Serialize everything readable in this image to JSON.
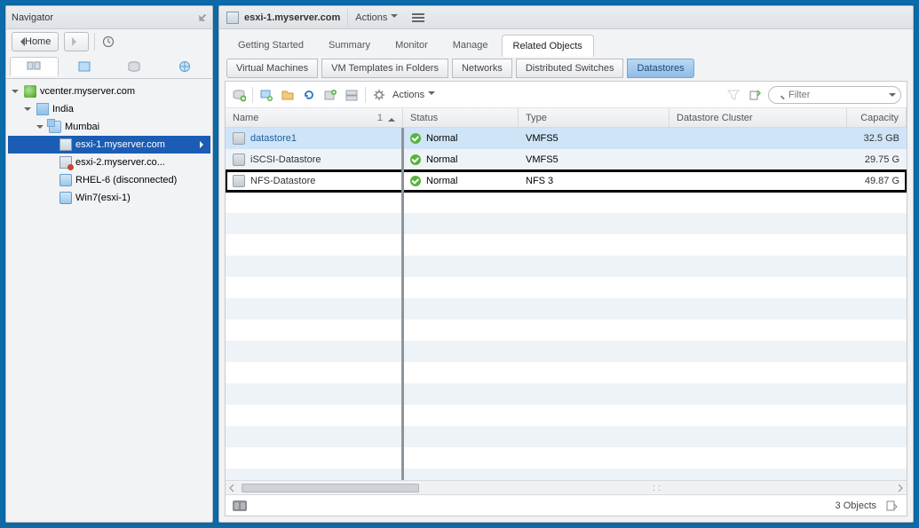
{
  "navigator": {
    "title": "Navigator",
    "home": "Home"
  },
  "tree": {
    "vcenter": "vcenter.myserver.com",
    "dc": "India",
    "cluster": "Mumbai",
    "host1": "esxi-1.myserver.com",
    "host2": "esxi-2.myserver.co...",
    "vm1": "RHEL-6 (disconnected)",
    "vm2": "Win7(esxi-1)"
  },
  "header": {
    "object": "esxi-1.myserver.com",
    "actions": "Actions"
  },
  "tabs": {
    "t0": "Getting Started",
    "t1": "Summary",
    "t2": "Monitor",
    "t3": "Manage",
    "t4": "Related Objects"
  },
  "subtabs": {
    "s0": "Virtual Machines",
    "s1": "VM Templates in Folders",
    "s2": "Networks",
    "s3": "Distributed Switches",
    "s4": "Datastores"
  },
  "toolbar": {
    "actions": "Actions",
    "filter_placeholder": "Filter"
  },
  "columns": {
    "name": "Name",
    "status": "Status",
    "type": "Type",
    "cluster": "Datastore Cluster",
    "capacity": "Capacity",
    "sort_indicator": "1"
  },
  "rows": [
    {
      "name": "datastore1",
      "status": "Normal",
      "type": "VMFS5",
      "capacity": "32.5 GB"
    },
    {
      "name": "iSCSI-Datastore",
      "status": "Normal",
      "type": "VMFS5",
      "capacity": "29.75 G"
    },
    {
      "name": "NFS-Datastore",
      "status": "Normal",
      "type": "NFS 3",
      "capacity": "49.87 G"
    }
  ],
  "statusbar": {
    "count": "3 Objects"
  }
}
